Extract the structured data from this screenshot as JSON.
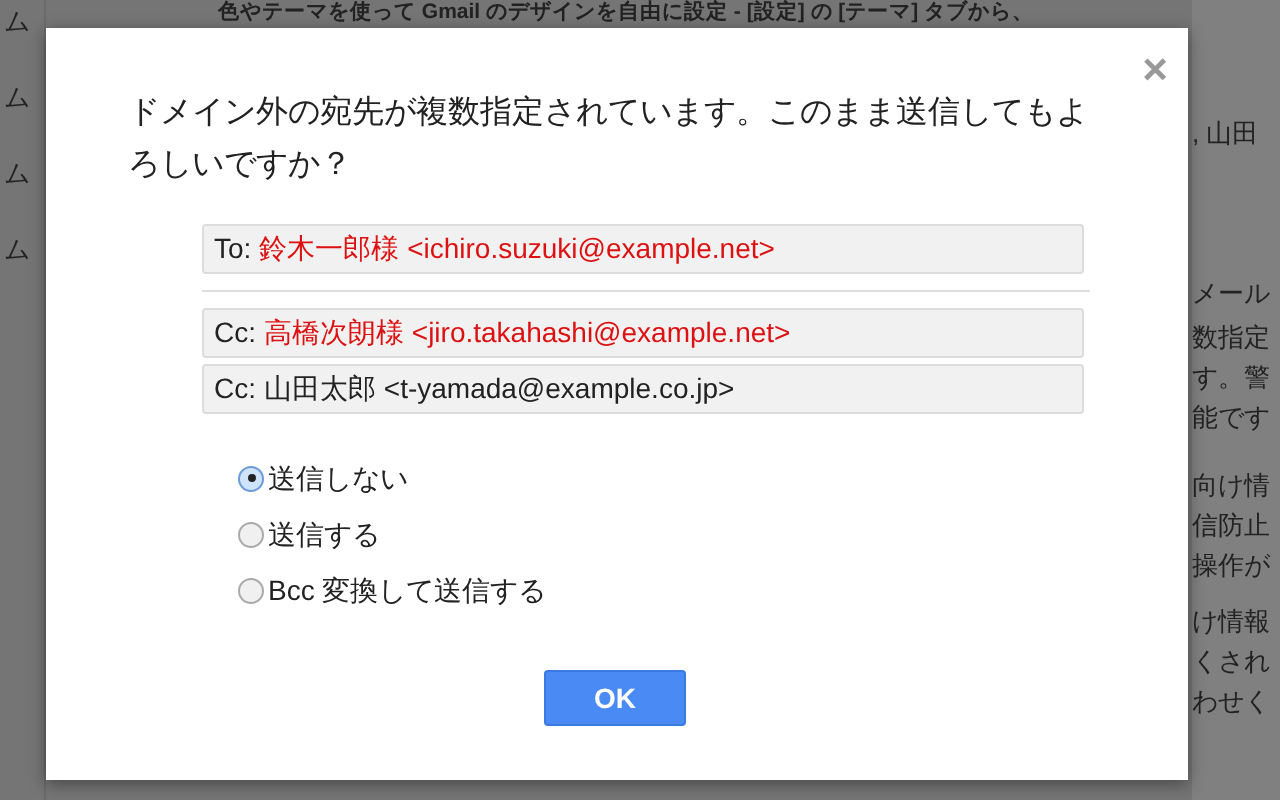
{
  "background": {
    "header": "色やテーマを使って Gmail のデザインを自由に設定 - [設定] の [テーマ] タブから、",
    "left_items": [
      "ム",
      "ム",
      "ム",
      "ム"
    ],
    "right_fragments": [
      ", 山田",
      "メール",
      "数指定",
      "す。警",
      "能です",
      "向け情",
      "信防止",
      "操作が",
      "け情報",
      "くされ",
      "わせく"
    ]
  },
  "dialog": {
    "close": "×",
    "message": "ドメイン外の宛先が複数指定されています。このまま送信してもよろしいですか？",
    "to": [
      {
        "label": "To:",
        "recipient": "鈴木一郎様 <ichiro.suzuki@example.net>",
        "external": true
      }
    ],
    "cc": [
      {
        "label": "Cc:",
        "recipient": "高橋次朗様 <jiro.takahashi@example.net>",
        "external": true
      },
      {
        "label": "Cc:",
        "recipient": "山田太郎 <t-yamada@example.co.jp>",
        "external": false
      }
    ],
    "options": [
      {
        "label": "送信しない",
        "selected": true
      },
      {
        "label": "送信する",
        "selected": false
      },
      {
        "label": "Bcc 変換して送信する",
        "selected": false
      }
    ],
    "ok_button": "OK"
  }
}
